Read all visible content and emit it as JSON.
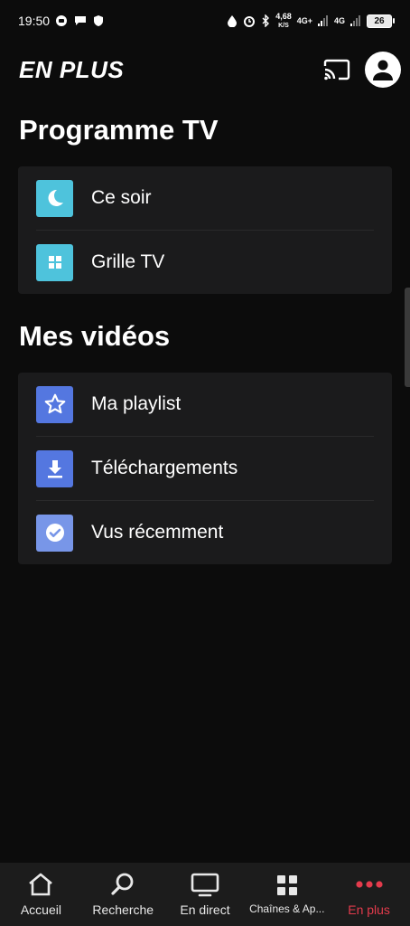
{
  "status_bar": {
    "time": "19:50",
    "speed_value": "4,68",
    "speed_unit": "K/S",
    "network1": "4G+",
    "network2": "4G",
    "battery": "26"
  },
  "header": {
    "brand": "EN PLUS"
  },
  "sections": {
    "tv": {
      "title": "Programme TV",
      "items": [
        {
          "label": "Ce soir",
          "icon": "moon-icon",
          "color": "#4ec3dc"
        },
        {
          "label": "Grille TV",
          "icon": "grid-icon",
          "color": "#4ec3dc"
        }
      ]
    },
    "videos": {
      "title": "Mes vidéos",
      "items": [
        {
          "label": "Ma playlist",
          "icon": "star-icon",
          "color": "#5477e0"
        },
        {
          "label": "Téléchargements",
          "icon": "download-icon",
          "color": "#5477e0"
        },
        {
          "label": "Vus récemment",
          "icon": "check-circle-icon",
          "color": "#7896e8"
        }
      ]
    }
  },
  "bottom_nav": {
    "items": [
      {
        "label": "Accueil",
        "icon": "home-icon"
      },
      {
        "label": "Recherche",
        "icon": "search-icon"
      },
      {
        "label": "En direct",
        "icon": "tv-icon"
      },
      {
        "label": "Chaînes & Ap...",
        "icon": "apps-icon"
      },
      {
        "label": "En plus",
        "icon": "more-dots-icon",
        "active": true
      }
    ],
    "active_color": "#e33b4c"
  }
}
